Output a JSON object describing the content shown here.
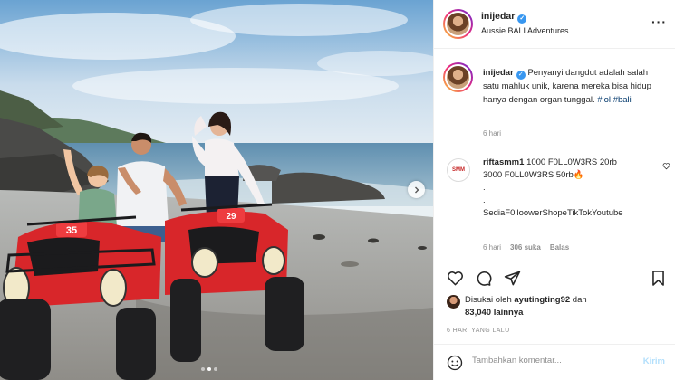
{
  "post": {
    "username": "inijedar",
    "location": "Aussie BALI Adventures",
    "caption": "Penyanyi dangdut adalah salah satu mahluk unik, karena mereka bisa hidup hanya dengan organ tunggal.",
    "hashtags": [
      "#lol",
      "#bali"
    ],
    "caption_time": "6 hari",
    "photo": {
      "atv_left_number": "35",
      "atv_right_number": "29",
      "carousel_dots": 3,
      "active_dot": 1
    }
  },
  "comments": [
    {
      "username": "riftasmm1",
      "text": "1000 F0LL0W3RS 20rb\n3000 F0LL0W3RS 50rb🔥\n.\n.\nSediaF0lloowerShopeTikTokYoutube",
      "time": "6 hari",
      "likes": "306 suka",
      "reply_label": "Balas"
    }
  ],
  "liked_by": {
    "prefix": "Disukai oleh",
    "user": "ayutingting92",
    "conjunction": "dan",
    "others": "83,040 lainnya"
  },
  "post_date": "6 HARI YANG LALU",
  "comment_box": {
    "placeholder": "Tambahkan komentar...",
    "post_label": "Kirim"
  },
  "icons": {
    "verified": "verified-badge-icon",
    "more": "more-options-icon",
    "like": "heart-icon",
    "comment": "comment-icon",
    "share": "paper-plane-icon",
    "save": "bookmark-icon",
    "emoji": "smiley-icon",
    "next": "chevron-right-icon"
  },
  "colors": {
    "verified": "#3897f0",
    "hashtag": "#00376b",
    "post_button_disabled": "#b2dffc",
    "atv_red": "#d8262a"
  }
}
